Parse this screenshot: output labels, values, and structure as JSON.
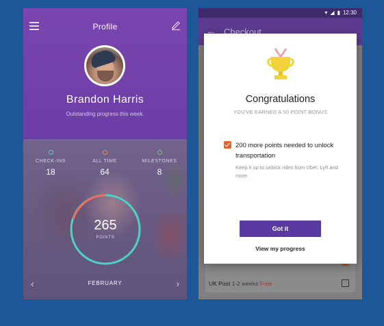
{
  "profile_screen": {
    "title": "Profile",
    "user_name": "Brandon Harris",
    "subtitle": "Outstanding progress this week.",
    "stats": [
      {
        "label": "CHECK-INS",
        "value": "18",
        "color": "#4fd1c5"
      },
      {
        "label": "ALL TIME",
        "value": "64",
        "color": "#f08a5d"
      },
      {
        "label": "MILESTONES",
        "value": "8",
        "color": "#7bc67e"
      }
    ],
    "points": {
      "value": "265",
      "label": "POINTS"
    },
    "month": "FEBRUARY",
    "icons": {
      "menu": "menu-icon",
      "edit": "edit-icon",
      "prev": "chevron-left-icon",
      "next": "chevron-right-icon"
    }
  },
  "checkout_screen": {
    "status_time": "12:30",
    "title": "Checkout",
    "dialog": {
      "title": "Congratulations",
      "subtitle": "YOU'VE EARNED A 50 POINT BONUS",
      "item_text": "200 more points needed to unlock transportation",
      "item_note": "Keep it up to unlock rides from Uber, Lyft and more",
      "primary_button": "Got it",
      "secondary_link": "View my progress"
    },
    "shipping_option": {
      "carrier": "UK Post",
      "duration": "1-2 weeks",
      "price": "Free"
    }
  },
  "colors": {
    "background": "#1c5797",
    "brand_purple": "#6b3ea5",
    "accent_orange": "#e5622e",
    "button_purple": "#5a3aa0"
  }
}
